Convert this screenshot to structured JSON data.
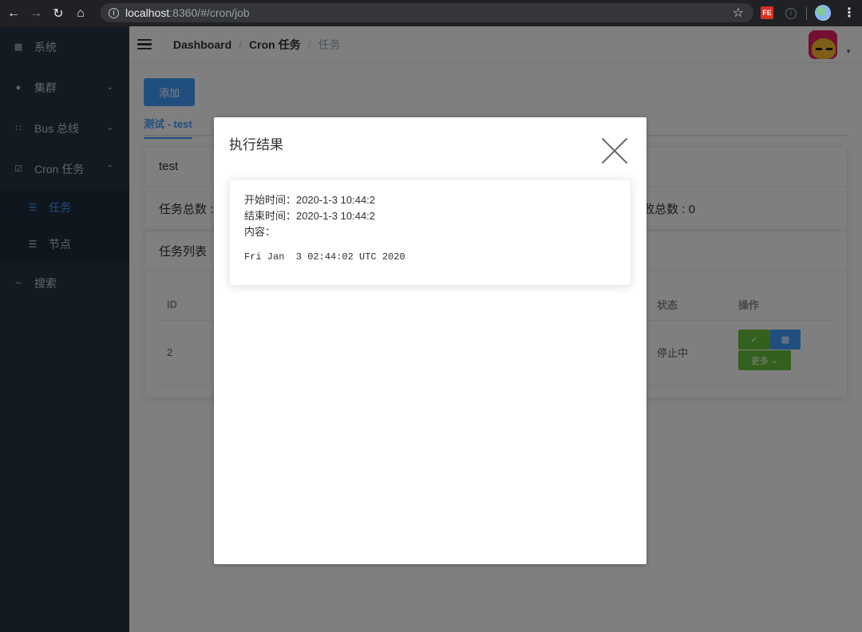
{
  "browser": {
    "url_host": "localhost",
    "url_rest": ":8360/#/cron/job",
    "ext_fe": "FE"
  },
  "sidebar": {
    "items": [
      {
        "label": "系统",
        "icon": "grid-icon"
      },
      {
        "label": "集群",
        "icon": "cluster-icon"
      },
      {
        "label": "Bus 总线",
        "icon": "bus-icon"
      },
      {
        "label": "Cron 任务",
        "icon": "calendar-check-icon"
      }
    ],
    "submenu": [
      {
        "label": "任务",
        "icon": "list-icon",
        "active": true
      },
      {
        "label": "节点",
        "icon": "list-icon",
        "active": false
      }
    ],
    "search_label": "搜索"
  },
  "navbar": {
    "breadcrumb": [
      "Dashboard",
      "Cron 任务",
      "任务"
    ]
  },
  "main": {
    "add_button": "添加",
    "tab_label": "测试 - test",
    "card_title": "test",
    "stat_total": "任务总数 :",
    "stat_fail": "败总数 : 0",
    "list_title": "任务列表",
    "table": {
      "headers": {
        "id": "ID",
        "status": "状态",
        "ops": "操作"
      },
      "rows": [
        {
          "id": "2",
          "status": "停止中"
        }
      ],
      "more_button": "更多"
    }
  },
  "modal": {
    "title": "执行结果",
    "start_time": "开始时间：2020-1-3 10:44:2",
    "end_time": "结束时间：2020-1-3 10:44:2",
    "content_label": "内容：",
    "content_output": "Fri Jan  3 02:44:02 UTC 2020"
  }
}
